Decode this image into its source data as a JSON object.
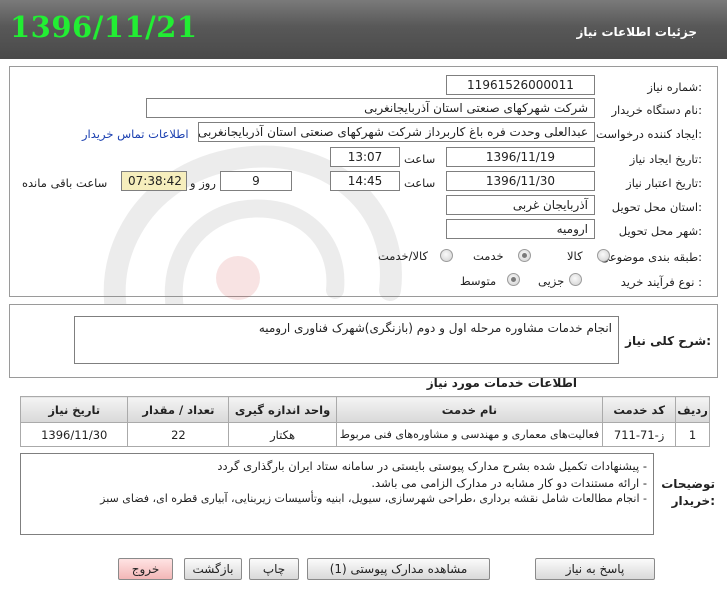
{
  "header": {
    "title": "جزئیات اطلاعات نیاز",
    "date_big": "1396/11/21"
  },
  "fields": {
    "need_number_label": "شماره نیاز:",
    "need_number": "11961526000011",
    "buyer_org_label": "نام دستگاه خریدار:",
    "buyer_org": "شرکت شهرکهای صنعتی استان آذربایجانغربی",
    "requester_label": "ایجاد کننده درخواست:",
    "requester": "عبدالعلی وحدت فره باغ کاربرداز شرکت شهرکهای صنعتی استان آذربایجانغربی",
    "contact_link": "اطلاعات تماس خریدار",
    "created_label": "تاریخ ایجاد نیاز:",
    "created_date": "1396/11/19",
    "time_label": "ساعت",
    "created_time": "13:07",
    "validity_label": "تاریخ اعتبار نیاز:",
    "validity_date": "1396/11/30",
    "validity_time": "14:45",
    "days": "9",
    "days_label": "روز و",
    "remaining": "07:38:42",
    "remaining_label": "ساعت باقی مانده",
    "province_label": "استان محل تحویل:",
    "province": "آذربایجان غربی",
    "city_label": "شهر محل تحویل:",
    "city": "ارومیه",
    "category_label": "طبقه بندی موضوعی:",
    "category_options": [
      "کالا",
      "خدمت",
      "کالا/خدمت"
    ],
    "category_selected": "خدمت",
    "process_label": "نوع فرآیند خرید :",
    "process_options": [
      "جزیی",
      "متوسط"
    ],
    "process_selected": "متوسط"
  },
  "description": {
    "label": "شرح کلی نیاز:",
    "text": "انجام خدمات مشاوره مرحله اول و دوم (بازنگری)شهرک فناوری ارومیه"
  },
  "services": {
    "title": "اطلاعات خدمات مورد نیاز",
    "columns": [
      "ردیف",
      "کد خدمت",
      "نام خدمت",
      "واحد اندازه گیری",
      "تعداد / مقدار",
      "تاریخ نیاز"
    ],
    "rows": [
      [
        "1",
        "ز-71-711",
        "فعالیت‌های معماری و مهندسی و مشاوره‌های فنی مربوط",
        "هکتار",
        "22",
        "1396/11/30"
      ]
    ]
  },
  "buyer_notes": {
    "label_line1": "توضیحات",
    "label_line2": "خریدار:",
    "lines": [
      "- پیشنهادات تکمیل شده بشرح مدارک پیوستی بایستی در سامانه ستاد ایران بارگذاری گردد",
      "- ارائه مستندات دو کار مشابه در مدارک الزامی می باشد.",
      "- انجام مطالعات شامل نقشه برداری ،طراحی شهرسازی، سیویل، ابنیه وتأسیسات زیربنایی، آبیاری قطره ای، فضای سبز"
    ]
  },
  "buttons": {
    "reply": "پاسخ به نیاز",
    "attachments": "مشاهده مدارک پیوستی (1)",
    "print": "چاپ",
    "back": "بازگشت",
    "exit": "خروج"
  }
}
